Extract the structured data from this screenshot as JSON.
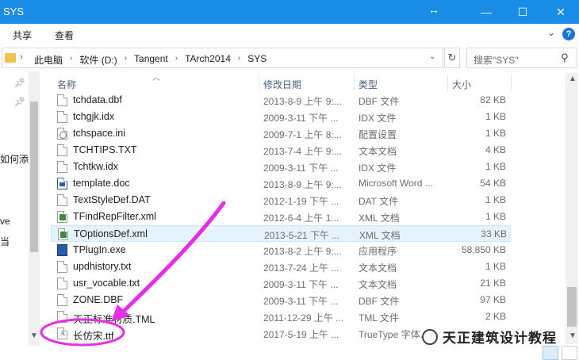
{
  "window": {
    "title": "SYS"
  },
  "ribbon": {
    "tabs": [
      "共享",
      "查看"
    ]
  },
  "address": {
    "crumbs": [
      "此电脑",
      "软件 (D:)",
      "Tangent",
      "TArch2014",
      "SYS"
    ],
    "search_placeholder": "搜索\"SYS\""
  },
  "nav": {
    "fragments": [
      "如何添",
      "ve",
      "当"
    ]
  },
  "columns": {
    "name": "名称",
    "date": "修改日期",
    "type": "类型",
    "size": "大小"
  },
  "files": [
    {
      "name": "tchdata.dbf",
      "date": "2013-8-9 上午 9:...",
      "type": "DBF 文件",
      "size": "82 KB",
      "icon": "file-icon"
    },
    {
      "name": "tchgjk.idx",
      "date": "2009-3-11 下午 ...",
      "type": "IDX 文件",
      "size": "1 KB",
      "icon": "file-icon"
    },
    {
      "name": "tchspace.ini",
      "date": "2009-7-1 上午 8:...",
      "type": "配置设置",
      "size": "1 KB",
      "icon": "settings-file-icon"
    },
    {
      "name": "TCHTIPS.TXT",
      "date": "2013-7-4 上午 9:...",
      "type": "文本文档",
      "size": "4 KB",
      "icon": "file-icon"
    },
    {
      "name": "Tchtkw.idx",
      "date": "2009-3-11 下午 ...",
      "type": "IDX 文件",
      "size": "1 KB",
      "icon": "file-icon"
    },
    {
      "name": "template.doc",
      "date": "2013-8-9 上午 9:...",
      "type": "Microsoft Word ...",
      "size": "54 KB",
      "icon": "word-doc-icon"
    },
    {
      "name": "TextStyleDef.DAT",
      "date": "2012-1-19 下午 ...",
      "type": "DAT 文件",
      "size": "1 KB",
      "icon": "file-icon"
    },
    {
      "name": "TFindRepFilter.xml",
      "date": "2012-6-4 上午 1...",
      "type": "XML 文档",
      "size": "1 KB",
      "icon": "xml-file-icon"
    },
    {
      "name": "TOptionsDef.xml",
      "date": "2013-5-21 下午 ...",
      "type": "XML 文档",
      "size": "33 KB",
      "icon": "xml-file-icon",
      "selected": true
    },
    {
      "name": "TPlugIn.exe",
      "date": "2013-8-2 上午 9:...",
      "type": "应用程序",
      "size": "58,850 KB",
      "icon": "exe-icon"
    },
    {
      "name": "updhistory.txt",
      "date": "2013-7-24 上午 ...",
      "type": "文本文档",
      "size": "1 KB",
      "icon": "file-icon"
    },
    {
      "name": "usr_vocable.txt",
      "date": "2009-3-11 下午 ...",
      "type": "文本文档",
      "size": "21 KB",
      "icon": "file-icon"
    },
    {
      "name": "ZONE.DBF",
      "date": "2009-3-11 下午 ...",
      "type": "DBF 文件",
      "size": "97 KB",
      "icon": "file-icon"
    },
    {
      "name": "天正标准材质.TML",
      "date": "2011-12-29 上午 ...",
      "type": "TML 文件",
      "size": "2 KB",
      "icon": "file-icon"
    },
    {
      "name": "长仿宋.ttf",
      "date": "2017-5-19 上午 ...",
      "type": "TrueType 字体...",
      "size": "",
      "icon": "font-file-icon"
    }
  ],
  "watermark": {
    "text": "天正建筑设计教程"
  },
  "colors": {
    "titlebar": "#1a8de6",
    "annotation": "#e62ee6",
    "selection": "#e5f3ff"
  }
}
